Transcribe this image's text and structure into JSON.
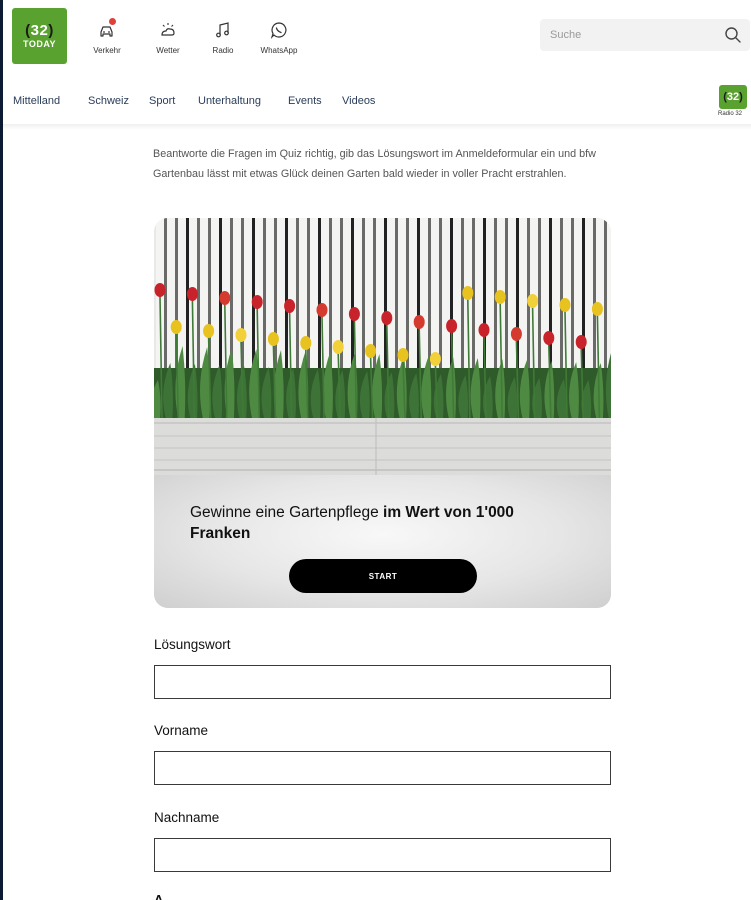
{
  "header": {
    "logo": {
      "number": "32",
      "word": "TODAY"
    },
    "quick_links": [
      {
        "label": "Verkehr",
        "icon": "car-alert-icon"
      },
      {
        "label": "Wetter",
        "icon": "weather-icon"
      },
      {
        "label": "Radio",
        "icon": "music-note-icon"
      },
      {
        "label": "WhatsApp",
        "icon": "whatsapp-icon"
      }
    ],
    "search": {
      "placeholder": "Suche",
      "value": ""
    }
  },
  "nav": {
    "items": [
      "Mittelland",
      "Schweiz",
      "Sport",
      "Unterhaltung",
      "Events",
      "Videos"
    ],
    "radio": {
      "number": "32",
      "label": "Radio 32"
    }
  },
  "content": {
    "intro": "Beantworte die Fragen im Quiz richtig, gib das Lösungswort im Anmeldeformular ein und bfw Gartenbau lässt mit etwas Glück deinen Garten bald wieder in voller Pracht erstrahlen.",
    "card": {
      "title_regular": "Gewinne eine Gartenpflege ",
      "title_bold": "im Wert von 1'000",
      "title_line2": "Franken",
      "button": "START"
    },
    "form": {
      "fields": [
        {
          "label": "Lösungswort",
          "value": ""
        },
        {
          "label": "Vorname",
          "value": ""
        },
        {
          "label": "Nachname",
          "value": ""
        }
      ],
      "next_label_partial": "A"
    }
  },
  "colors": {
    "brand_green": "#5aa22f",
    "badge_red": "#e0403b",
    "nav_text": "#2a3d5a",
    "button_bg": "#000000",
    "frame_bg": "#0c1b33"
  }
}
